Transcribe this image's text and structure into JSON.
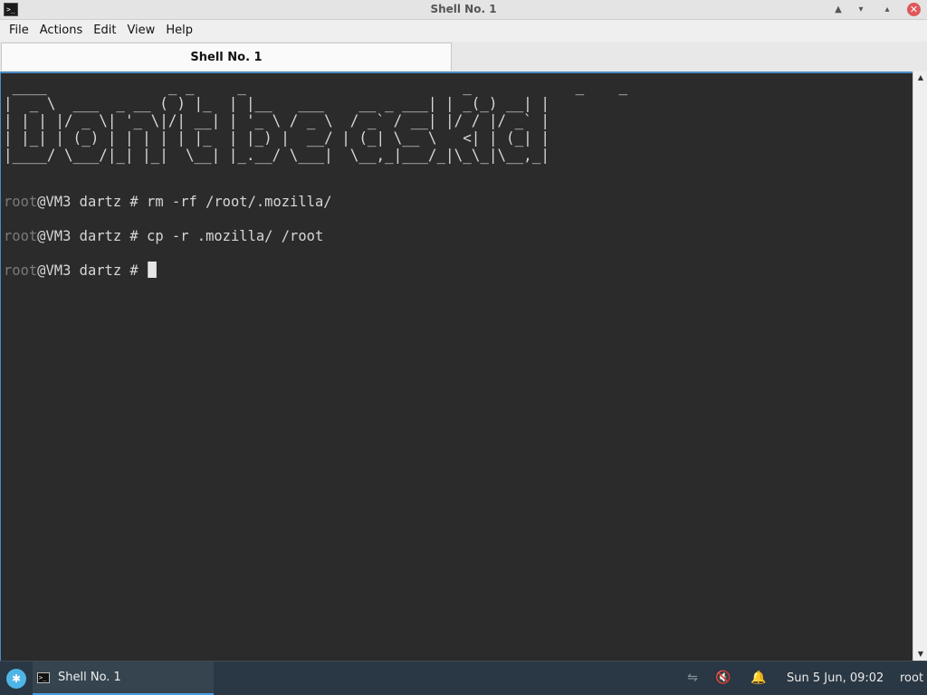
{
  "window": {
    "title": "Shell No. 1",
    "icon": "terminal-icon",
    "buttons": {
      "shade": "▲",
      "minimize": "▾",
      "maximize": "▴",
      "close": "✕"
    }
  },
  "menu": {
    "file": "File",
    "actions": "Actions",
    "edit": "Edit",
    "view": "View",
    "help": "Help"
  },
  "tabs": [
    {
      "label": "Shell No. 1",
      "active": true
    }
  ],
  "terminal": {
    "banner": " ____              _ _     _                         _            _    _ \n|  _ \\  ___  _ __ ( ) |_  | |__   ___    __ _ ___| | _(_) __| |\n| | | |/ _ \\| '_ \\|/| __| | '_ \\ / _ \\  / _` / __| |/ / |/ _` |\n| |_| | (_) | | | | | |_  | |_) |  __/ | (_| \\__ \\   <| | (_| |\n|____/ \\___/|_| |_|  \\__| |_.__/ \\___|  \\__,_|___/_|\\_\\_|\\__,_|",
    "lines": [
      {
        "user": "root",
        "rest": "@VM3 dartz # rm -rf /root/.mozilla/"
      },
      {
        "user": "root",
        "rest": "@VM3 dartz # cp -r .mozilla/ /root"
      },
      {
        "user": "root",
        "rest": "@VM3 dartz # "
      }
    ],
    "colors": {
      "background": "#2b2b2b",
      "text": "#d6d6d6",
      "user": "#7a7a7a",
      "accent": "#4a8cc7"
    }
  },
  "scrollbar": {
    "up": "▲",
    "down": "▼"
  },
  "taskbar": {
    "start_icon": "✱",
    "task_label": "Shell No. 1",
    "task_icon_glyph": ">_",
    "network_icon": "⇋",
    "volume_icon": "🔇",
    "bell_icon": "🔔",
    "clock": "Sun  5 Jun, 09:02",
    "user": "root"
  }
}
